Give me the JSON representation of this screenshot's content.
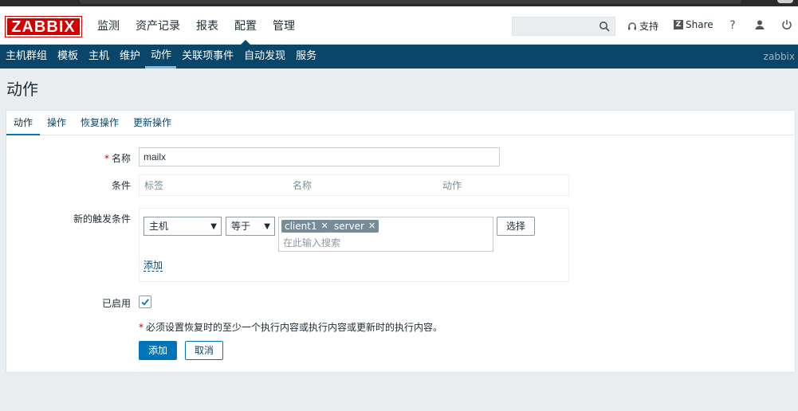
{
  "logo": {
    "text": "ZABBIX"
  },
  "top_menu": [
    {
      "label": "监测"
    },
    {
      "label": "资产记录"
    },
    {
      "label": "报表"
    },
    {
      "label": "配置",
      "active": true
    },
    {
      "label": "管理"
    }
  ],
  "header": {
    "support_label": "支持",
    "share_label": "Share",
    "share_badge": "Z",
    "help_label": "?"
  },
  "sub_menu": [
    {
      "label": "主机群组"
    },
    {
      "label": "模板"
    },
    {
      "label": "主机"
    },
    {
      "label": "维护"
    },
    {
      "label": "动作",
      "active": true
    },
    {
      "label": "关联项事件"
    },
    {
      "label": "自动发现"
    },
    {
      "label": "服务"
    }
  ],
  "sub_menu_user": "zabbix",
  "page_title": "动作",
  "tabs": [
    {
      "label": "动作",
      "active": true
    },
    {
      "label": "操作"
    },
    {
      "label": "恢复操作"
    },
    {
      "label": "更新操作"
    }
  ],
  "form": {
    "name_required": "*",
    "name_label": "名称",
    "name_value": "mailx",
    "conditions_label": "条件",
    "conditions_headers": [
      "标签",
      "名称",
      "动作"
    ],
    "new_condition_label": "新的触发条件",
    "condition_type": "主机",
    "condition_operator": "等于",
    "selected_hosts": [
      "client1",
      "server"
    ],
    "search_placeholder": "在此输入搜索",
    "select_button": "选择",
    "add_link": "添加",
    "enabled_label": "已启用",
    "enabled": true,
    "required_note_star": "*",
    "required_note": "必须设置恢复时的至少一个执行内容或执行内容或更新时的执行内容。",
    "add_button": "添加",
    "cancel_button": "取消"
  },
  "colors": {
    "brand": "#d40000",
    "nav": "#0a466a",
    "primary": "#0275b8"
  }
}
